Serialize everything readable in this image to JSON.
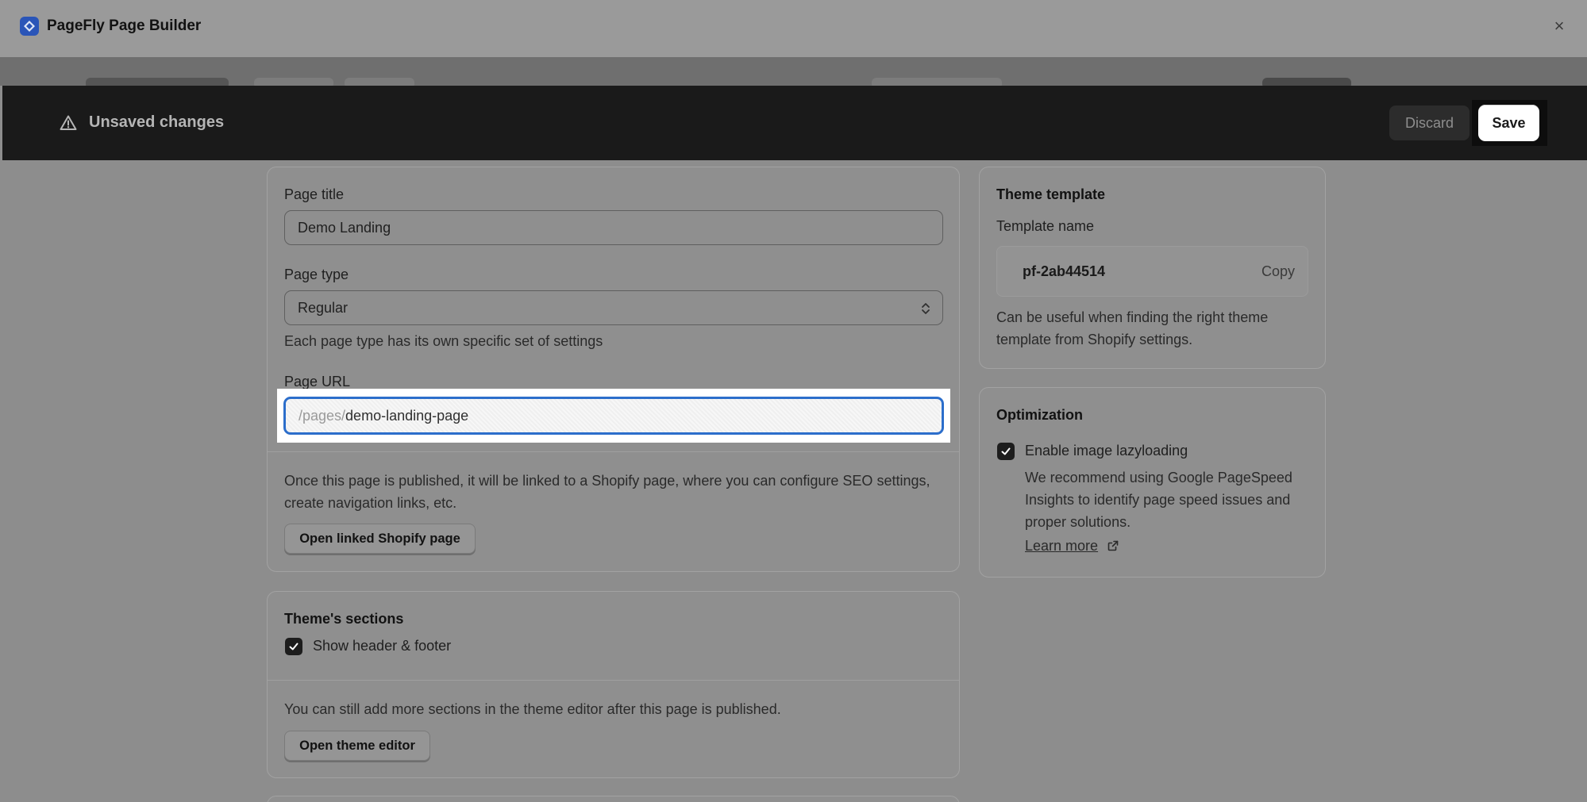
{
  "window": {
    "app_title": "PageFly Page Builder",
    "close_glyph": "×"
  },
  "savebar": {
    "title": "Unsaved changes",
    "discard_label": "Discard",
    "save_label": "Save"
  },
  "page_settings": {
    "page_title_label": "Page title",
    "page_title_value": "Demo Landing",
    "page_type_label": "Page type",
    "page_type_value": "Regular",
    "page_type_help": "Each page type has its own specific set of settings",
    "page_url_label": "Page URL",
    "page_url_prefix": "/pages/",
    "page_url_value": "demo-landing-page",
    "linked_help": "Once this page is published, it will be linked to a Shopify page, where you can configure SEO settings, create navigation links, etc.",
    "open_linked_label": "Open linked Shopify page"
  },
  "theme_sections": {
    "heading": "Theme's sections",
    "show_header_footer_label": "Show header & footer",
    "show_header_footer_checked": true,
    "help": "You can still add more sections in the theme editor after this page is published.",
    "open_theme_editor_label": "Open theme editor"
  },
  "theme_template": {
    "heading": "Theme template",
    "template_name_label": "Template name",
    "template_name_value": "pf-2ab44514",
    "copy_label": "Copy",
    "help": "Can be useful when finding the right theme template from Shopify settings."
  },
  "optimization": {
    "heading": "Optimization",
    "lazyload_label": "Enable image lazyloading",
    "lazyload_checked": true,
    "help": "We recommend using Google PageSpeed Insights to identify page speed issues and proper solutions.",
    "learn_more_label": "Learn more"
  },
  "icons": {
    "app_logo": "pagefly-logo-icon",
    "warning": "warning-triangle-icon",
    "select_chevrons": "chevron-up-down-icon",
    "checkmark": "checkmark-icon",
    "external_link": "external-link-icon"
  },
  "colors": {
    "accent_focus": "#2c6ecb",
    "savebar_bg": "#1a1a1a",
    "overlay_bg": "#8d8d8d"
  }
}
